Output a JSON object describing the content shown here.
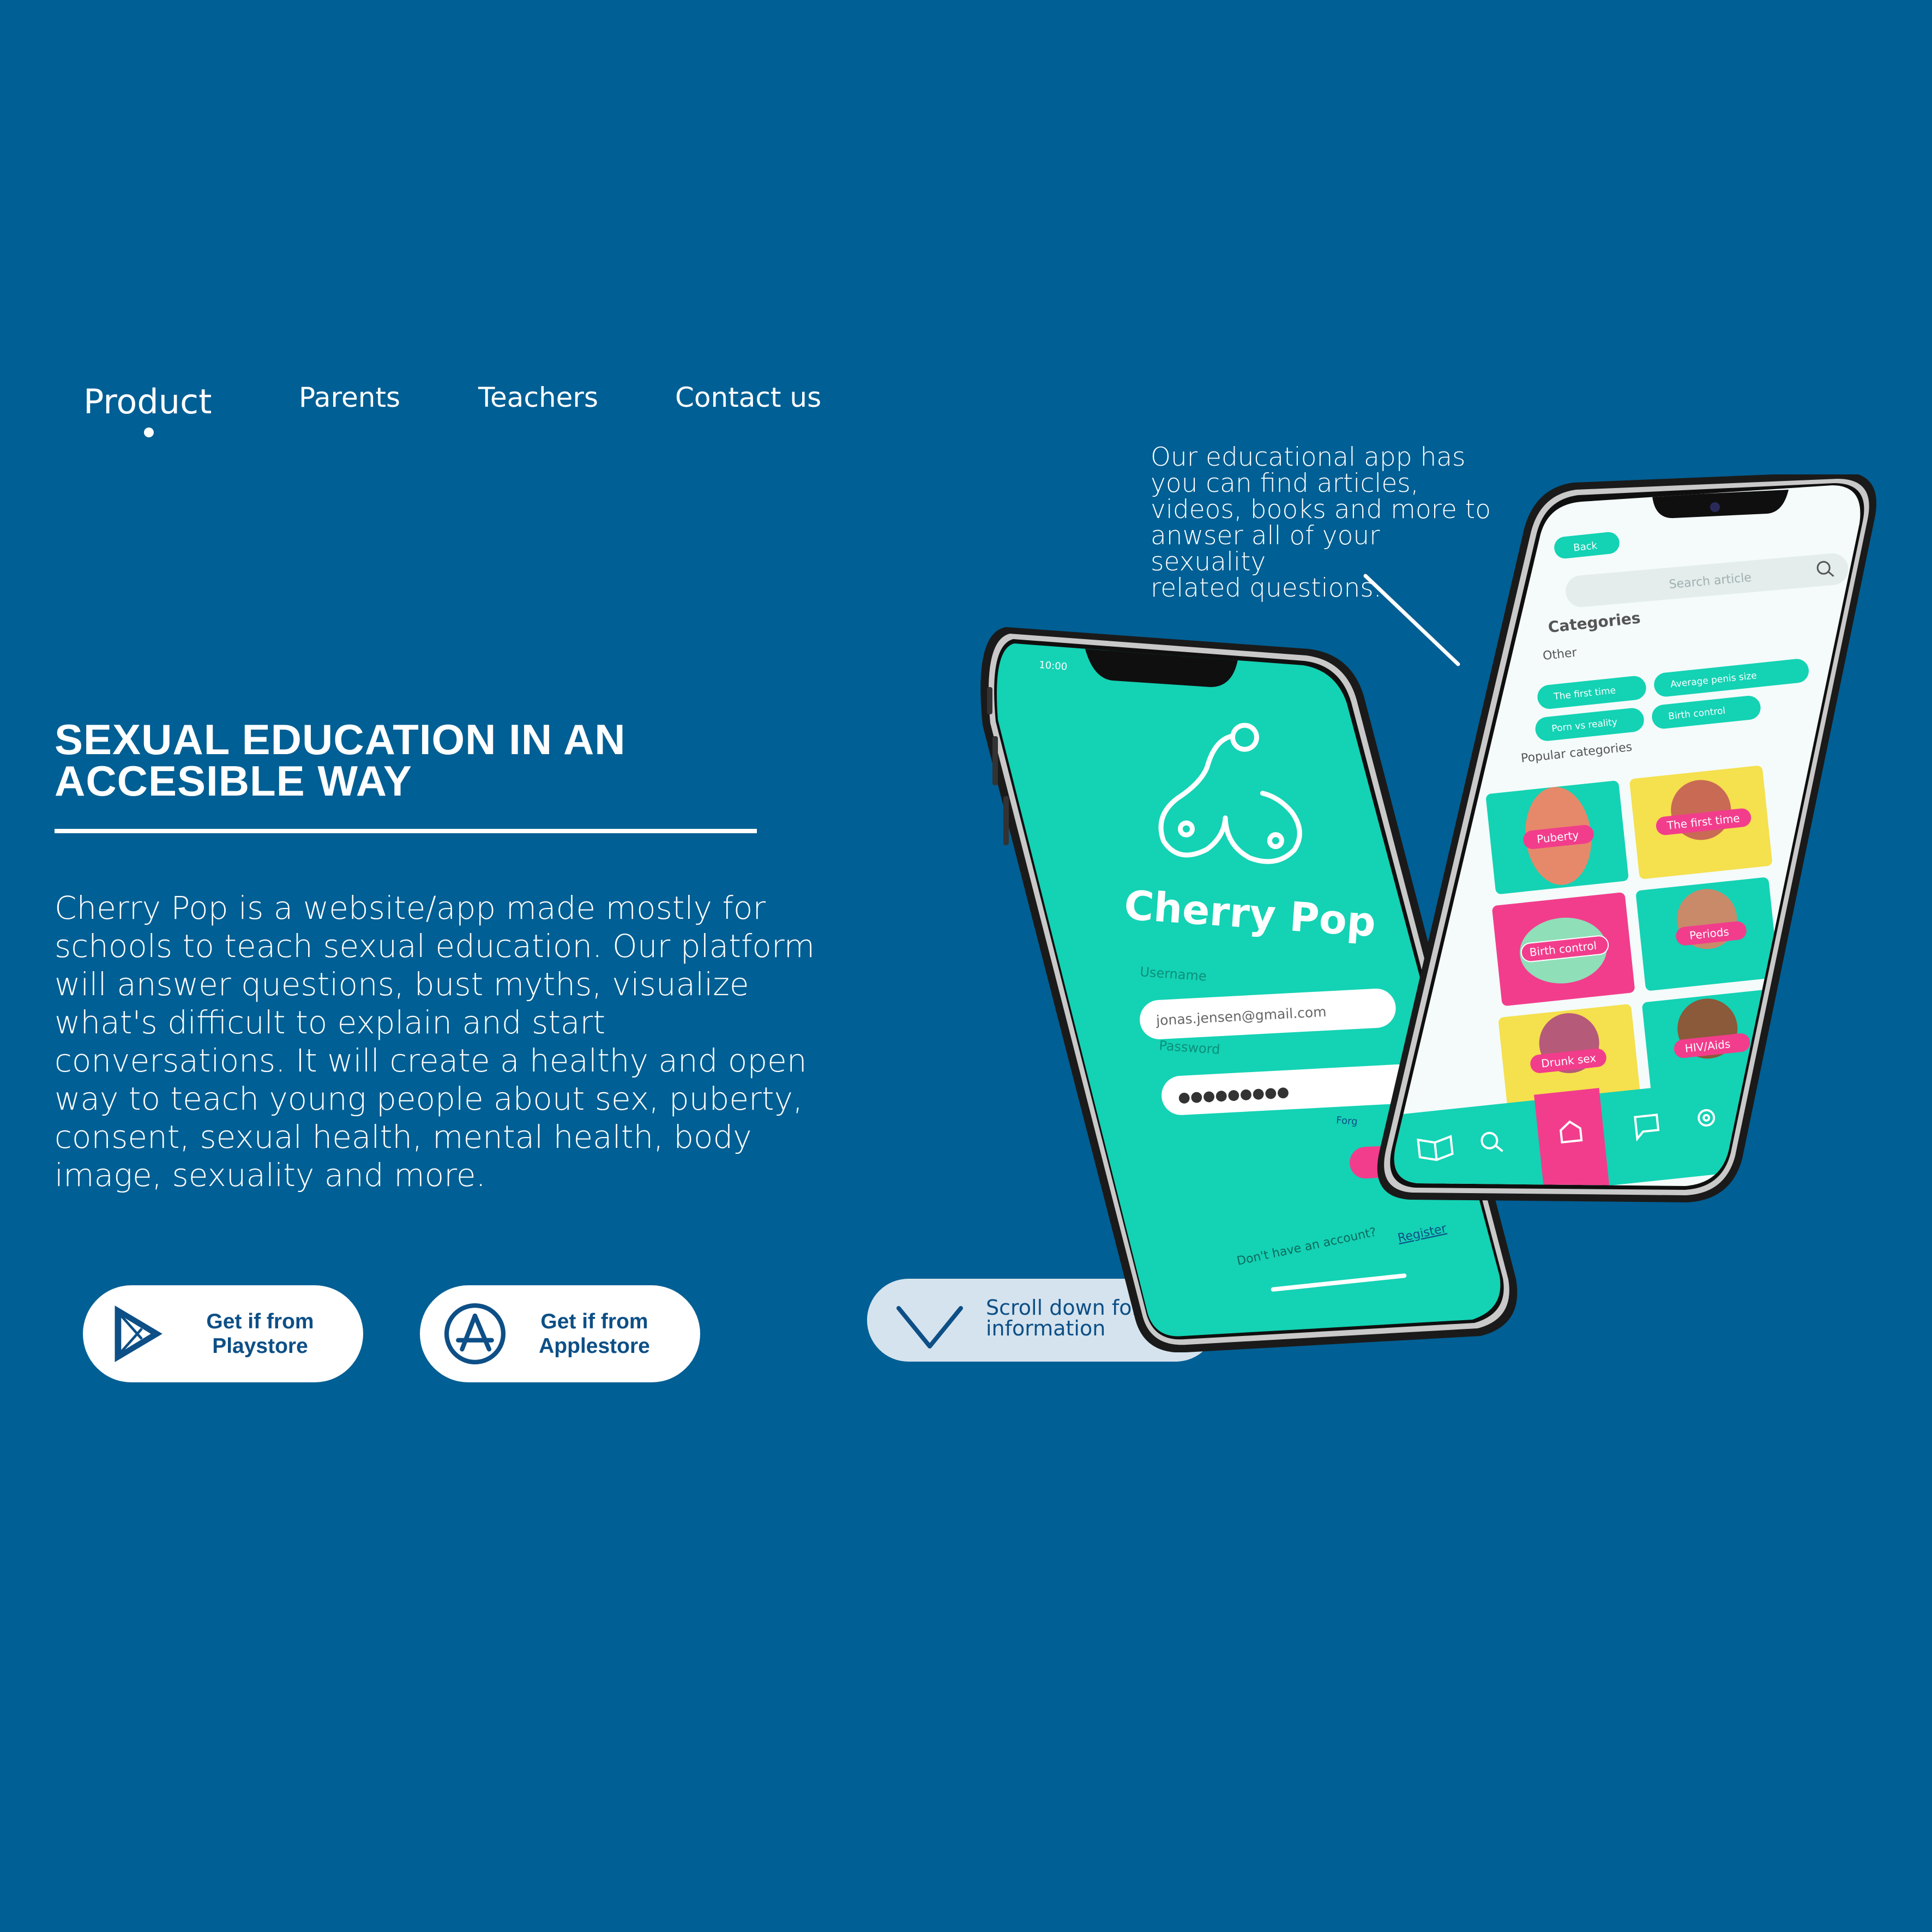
{
  "nav": {
    "items": [
      {
        "label": "Product",
        "active": true
      },
      {
        "label": "Parents"
      },
      {
        "label": "Teachers"
      },
      {
        "label": "Contact us"
      }
    ]
  },
  "hero": {
    "headline_line1": "SEXUAL EDUCATION IN AN",
    "headline_line2": "ACCESIBLE WAY",
    "description": "Cherry Pop is a website/app made mostly for schools to teach sexual education. Our platform will answer questions, bust myths, visualize what's difficult to explain and start conversations. It will create a healthy and open way to teach young people about sex, puberty, consent, sexual health, mental health, body image, sexuality and more."
  },
  "store_buttons": {
    "playstore": {
      "line1": "Get if from",
      "line2": "Playstore",
      "icon": "play-store-icon"
    },
    "applestore": {
      "line1": "Get if from",
      "line2": "Applestore",
      "icon": "app-store-icon"
    }
  },
  "scroll_hint": {
    "line1": "Scroll down for more",
    "line2": "information",
    "icon": "chevron-down-icon"
  },
  "callout": {
    "lines": [
      "Our educational app has",
      "you can find articles,",
      "videos, books and more to",
      "anwser all of your sexuality",
      "related questions."
    ]
  },
  "login_screen": {
    "status_time": "10:00",
    "app_name": "Cherry Pop",
    "username_label": "Username",
    "username_value": "jonas.jensen@gmail.com",
    "password_label": "Password",
    "password_value": "●●●●●●●●●",
    "forgot_partial": "Forg",
    "register_prompt": "Don't have an account?",
    "register_link": "Register"
  },
  "browse_screen": {
    "back_label": "Back",
    "search_placeholder": "Search article",
    "categories_heading": "Categories",
    "other_heading": "Other",
    "chips": [
      "The first time",
      "Average penis size",
      "Porn vs reality",
      "Birth control"
    ],
    "popular_heading": "Popular categories",
    "tiles": [
      "Puberty",
      "The first time",
      "Birth control",
      "Periods",
      "Drunk sex",
      "HIV/Aids"
    ],
    "tab_icons": [
      "book-icon",
      "search-icon",
      "home-icon",
      "chat-icon",
      "settings-icon"
    ]
  },
  "colors": {
    "background": "#005f94",
    "teal": "#14d2b4",
    "pink": "#f23d8c",
    "button_text": "#0d4f86"
  }
}
